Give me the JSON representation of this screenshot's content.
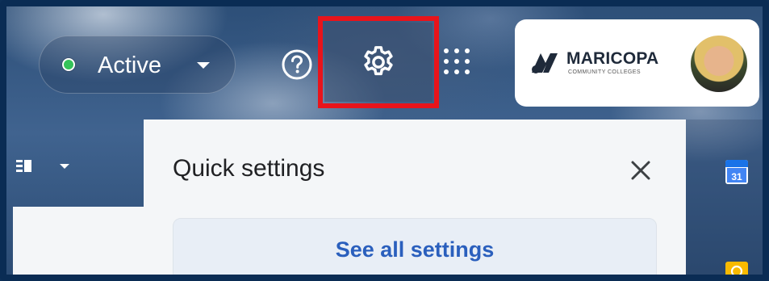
{
  "status": {
    "label": "Active",
    "dot_color": "#34c259",
    "icon": "chevron-down-icon"
  },
  "header_icons": {
    "help": "help-circle-icon",
    "settings": "gear-icon",
    "apps": "apps-grid-icon"
  },
  "highlight_color": "#e8141b",
  "account": {
    "org_name": "MARICOPA",
    "org_subtitle": "COMMUNITY COLLEGES",
    "logo": "maricopa-logo",
    "avatar": "user-avatar"
  },
  "toolbar": {
    "view_toggle_icon": "split-pane-icon"
  },
  "quick_settings": {
    "title": "Quick settings",
    "close_icon": "close-icon",
    "see_all_label": "See all settings"
  },
  "side_panel": {
    "calendar_day": "31",
    "calendar_icon": "calendar-icon",
    "keep_icon": "keep-bulb-icon"
  },
  "colors": {
    "link_blue": "#2a5fbd",
    "panel_bg": "#f4f6f8"
  }
}
